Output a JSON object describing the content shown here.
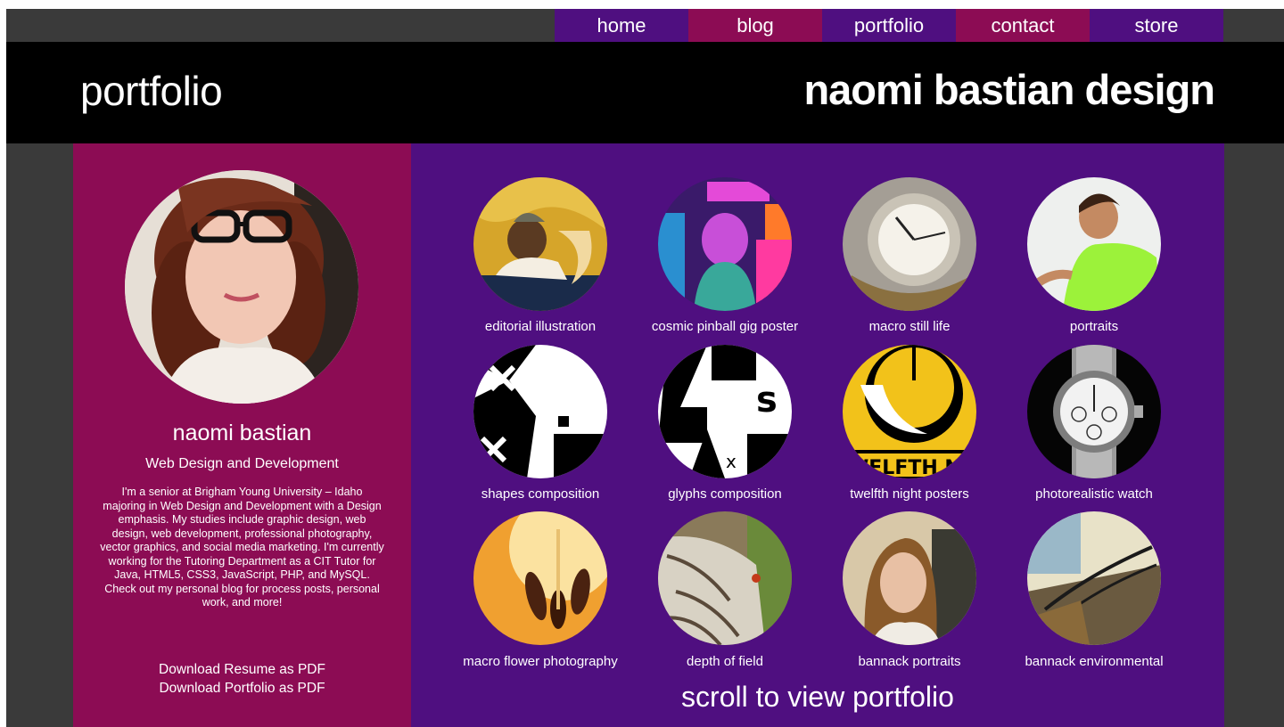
{
  "nav": {
    "items": [
      {
        "label": "home",
        "color": "#4f0f80"
      },
      {
        "label": "blog",
        "color": "#8c0c54"
      },
      {
        "label": "portfolio",
        "color": "#4f0f80"
      },
      {
        "label": "contact",
        "color": "#8c0c54"
      },
      {
        "label": "store",
        "color": "#4f0f80"
      }
    ]
  },
  "header": {
    "page_title": "portfolio",
    "site_title": "naomi bastian design"
  },
  "profile": {
    "name": "naomi bastian",
    "role": "Web Design and Development",
    "bio": "I'm a senior at Brigham Young University – Idaho majoring in Web Design and Development with a Design emphasis. My studies include graphic design, web design, web development, professional photography, vector graphics, and social media marketing. I'm currently working for the Tutoring Department as a CIT Tutor for Java, HTML5, CSS3, JavaScript, PHP, and MySQL. Check out my personal blog for process posts, personal work, and more!",
    "download_resume": "Download Resume as PDF",
    "download_portfolio": "Download Portfolio as PDF"
  },
  "portfolio": {
    "items": [
      {
        "caption": "editorial illustration"
      },
      {
        "caption": "cosmic pinball gig poster"
      },
      {
        "caption": "macro still life"
      },
      {
        "caption": "portraits"
      },
      {
        "caption": "shapes composition"
      },
      {
        "caption": "glyphs composition"
      },
      {
        "caption": "twelfth night posters"
      },
      {
        "caption": "photorealistic watch"
      },
      {
        "caption": "macro flower photography"
      },
      {
        "caption": "depth of field"
      },
      {
        "caption": "bannack portraits"
      },
      {
        "caption": "bannack environmental"
      }
    ],
    "scroll_hint": "scroll to view portfolio"
  },
  "colors": {
    "purple": "#4f0f80",
    "magenta": "#8c0c54",
    "frame": "#3a3a3a",
    "header": "#000000"
  }
}
